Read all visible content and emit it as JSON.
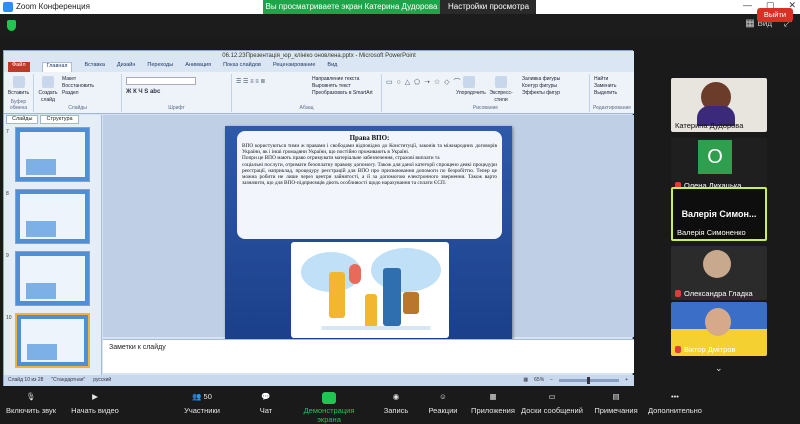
{
  "zoom": {
    "window_title": "Zoom Конференция",
    "share_banner": "Вы просматриваете экран Катерина Дудорова",
    "view_options": "Настройки просмотра",
    "view_button": "Вид"
  },
  "ppt": {
    "window_title": "06.12.23Презентація_юр_клініко оновлена.pptx - Microsoft PowerPoint",
    "tabs": [
      "Файл",
      "Главная",
      "Вставка",
      "Дизайн",
      "Переходы",
      "Анимация",
      "Показ слайдов",
      "Рецензирование",
      "Вид"
    ],
    "ribbon": {
      "clipboard_group": "Буфер обмена",
      "paste": "Вставить",
      "slides_group": "Слайды",
      "create_slide": "Создать слайд",
      "layout": "Макет",
      "reset": "Восстановить",
      "section": "Раздел",
      "font_group": "Шрифт",
      "paragraph_group": "Абзац",
      "text_direction": "Направление текста",
      "align_text": "Выровнять текст",
      "convert_smartart": "Преобразовать в SmartArt",
      "drawing_group": "Рисование",
      "arrange": "Упорядочить",
      "quick_styles": "Экспресс-стили",
      "shape_fill": "Заливка фигуры",
      "shape_outline": "Контур фигуры",
      "shape_effects": "Эффекты фигур",
      "editing_group": "Редактирование",
      "find": "Найти",
      "replace": "Заменить",
      "select": "Выделить"
    },
    "pane_tabs": [
      "Слайды",
      "Структура"
    ],
    "slide_numbers": [
      "7",
      "8",
      "9",
      "10"
    ],
    "slide": {
      "heading": "Права ВПО:",
      "paragraph1": "ВПО користуються тими ж правами і свободами відповідно до Конституції, законів та міжнародних договорів України, як і інші громадяни України, що постійно проживають в Україні.",
      "paragraph2": "Попри це ВПО мають право отримувати матеріальне забезпечення, страхові виплати та",
      "paragraph3": "соціальні послуги, отримати безоплатну правову допомогу. Також для даної категорії спрощено деякі процедури реєстрації, наприклад, процедуру реєстрацій для ВПО про присвоювання допомоги по безробіттю. Тепер це можна робити не лише через центри зайнятості, а й за допомогою електронного звернення. Також варто зазначити, що для ВПО-підприємців діють особливості щодо нарахування та сплати ЄСП."
    },
    "notes_placeholder": "Заметки к слайду",
    "status": {
      "slide_count": "Слайд 10 из 28",
      "theme": "\"Стандартная\"",
      "language": "русский",
      "zoom": "65%"
    }
  },
  "participants": [
    {
      "name": "Катерина Дудорова",
      "muted": false
    },
    {
      "name": "Олена Лихацька",
      "initial": "О",
      "muted": true
    },
    {
      "name": "Валерія Симоненко",
      "big_label": "Валерія Симон...",
      "muted": false
    },
    {
      "name": "Олександра Гладка",
      "muted": true
    },
    {
      "name": "Віктор Дмітров",
      "muted": true
    }
  ],
  "toolbar": {
    "unmute": "Включить звук",
    "start_video": "Начать видео",
    "participants": "Участники",
    "participants_count": "50",
    "chat": "Чат",
    "share": "Демонстрация экрана",
    "record": "Запись",
    "reactions": "Реакции",
    "apps": "Приложения",
    "whiteboard": "Доски сообщений",
    "notes": "Примечания",
    "more": "Дополнительно",
    "leave": "Выйти"
  },
  "colors": {
    "share_green": "#23c552",
    "leave_red": "#d93025",
    "active_speaker": "#c9f04d",
    "slide_blue": "#2e5aa8"
  }
}
